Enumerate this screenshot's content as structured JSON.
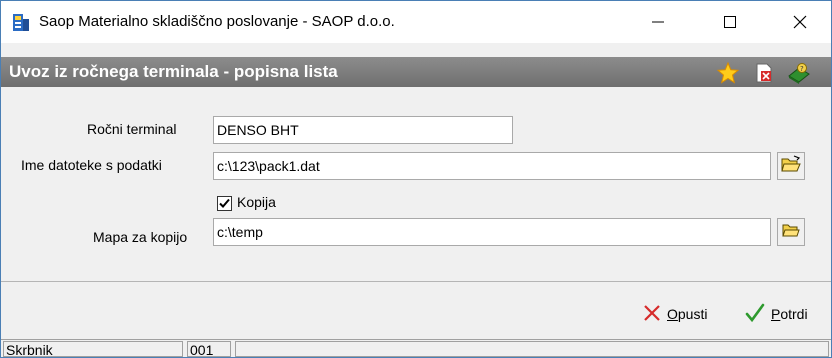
{
  "window": {
    "title": "Saop Materialno skladiščno poslovanje - SAOP d.o.o."
  },
  "dialog": {
    "title": "Uvoz iz ročnega terminala - popisna lista"
  },
  "form": {
    "terminal_label": "Ročni terminal",
    "terminal_value": "DENSO BHT",
    "file_label": "Ime datoteke s podatki",
    "file_value": "c:\\123\\pack1.dat",
    "copy_label": "Kopija",
    "copy_checked": true,
    "copy_folder_label": "Mapa za kopijo",
    "copy_folder_value": "c:\\temp"
  },
  "actions": {
    "cancel_prefix": "O",
    "cancel_rest": "pusti",
    "confirm_prefix": "P",
    "confirm_rest": "otrdi"
  },
  "status": {
    "user": "Skrbnik",
    "code": "001",
    "message": ""
  },
  "colors": {
    "header_bg": "#7d7d7d",
    "cancel_icon": "#d62b2b",
    "confirm_icon": "#2e9a2e"
  }
}
